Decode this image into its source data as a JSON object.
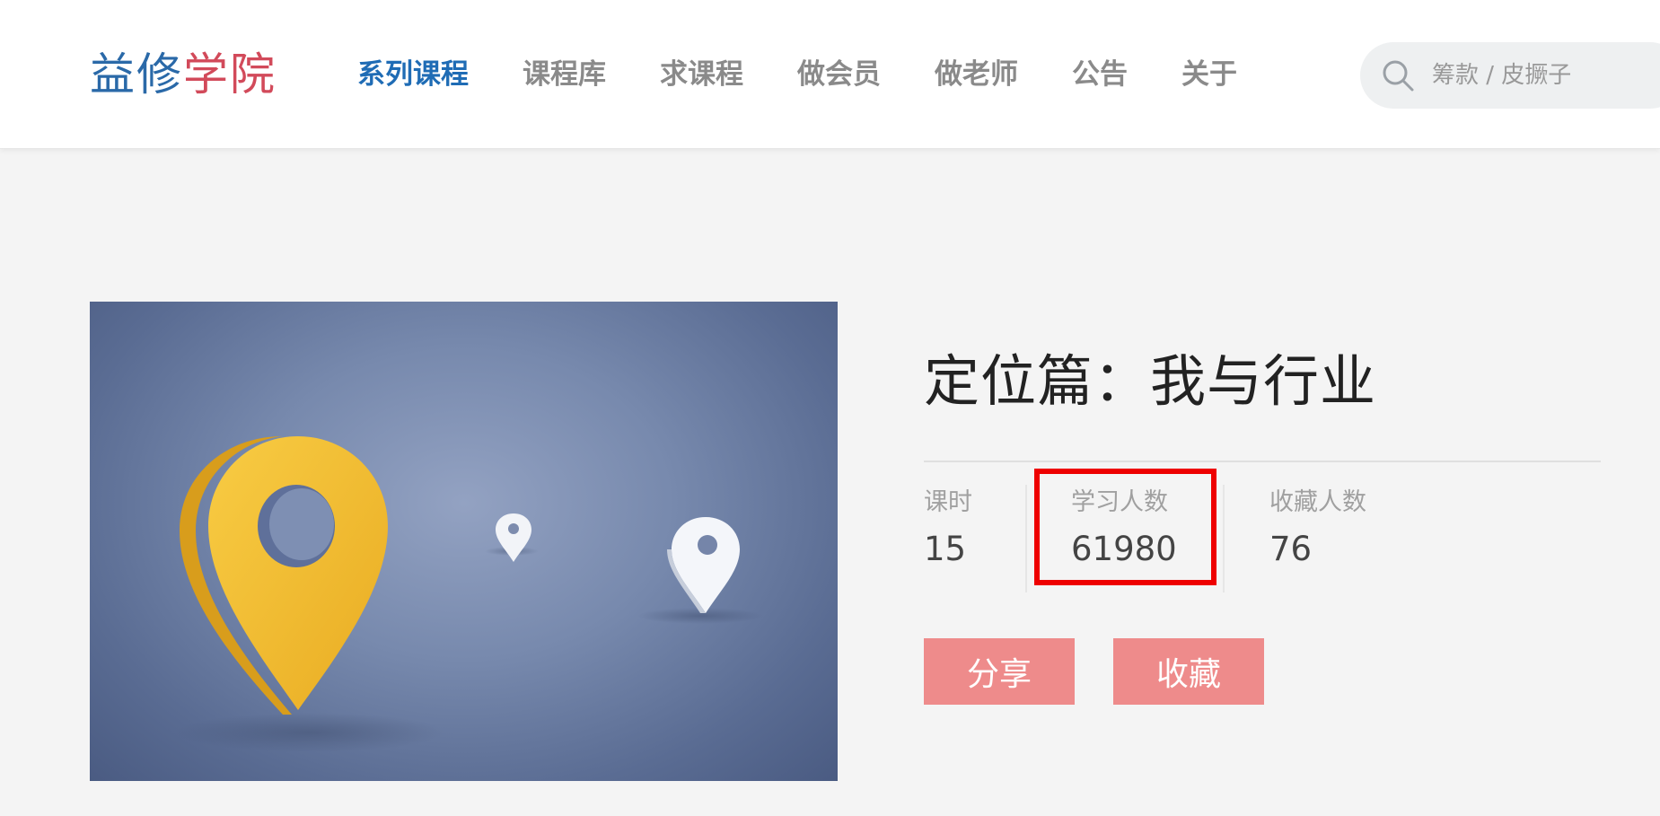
{
  "header": {
    "logo": {
      "part1": "益修",
      "part2": "学院",
      "color1": "#2a69a8",
      "color2": "#d24a5a"
    },
    "nav": [
      {
        "label": "系列课程",
        "active": true
      },
      {
        "label": "课程库",
        "active": false
      },
      {
        "label": "求课程",
        "active": false
      },
      {
        "label": "做会员",
        "active": false
      },
      {
        "label": "做老师",
        "active": false
      },
      {
        "label": "公告",
        "active": false
      },
      {
        "label": "关于",
        "active": false
      }
    ],
    "search": {
      "placeholder": "筹款 / 皮撅子",
      "icon": "search-icon"
    }
  },
  "course": {
    "title": "定位篇：我与行业",
    "cover_icon": "map-pin-icon",
    "stats": [
      {
        "label": "课时",
        "value": "15"
      },
      {
        "label": "学习人数",
        "value": "61980"
      },
      {
        "label": "收藏人数",
        "value": "76"
      }
    ],
    "buttons": {
      "share": "分享",
      "favorite": "收藏"
    }
  },
  "colors": {
    "accent": "#1f6cb5",
    "button": "#ee8b8b",
    "highlight": "#ee0000",
    "pin_yellow": "#f0bb30"
  }
}
